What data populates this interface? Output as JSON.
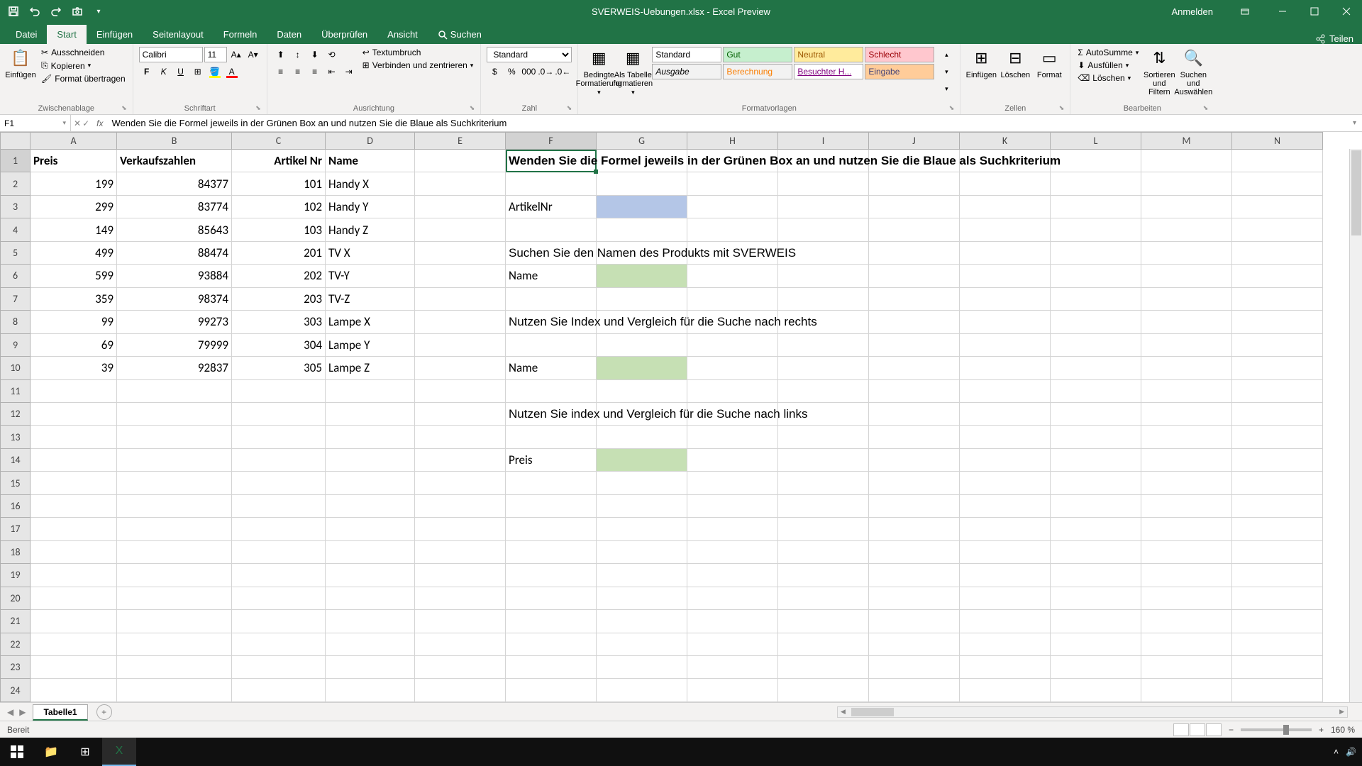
{
  "titlebar": {
    "title": "SVERWEIS-Uebungen.xlsx - Excel Preview",
    "signin": "Anmelden"
  },
  "ribbon_tabs": {
    "file": "Datei",
    "home": "Start",
    "insert": "Einfügen",
    "page_layout": "Seitenlayout",
    "formulas": "Formeln",
    "data": "Daten",
    "review": "Überprüfen",
    "view": "Ansicht",
    "search": "Suchen",
    "share": "Teilen"
  },
  "ribbon": {
    "clipboard": {
      "label": "Zwischenablage",
      "paste": "Einfügen",
      "cut": "Ausschneiden",
      "copy": "Kopieren",
      "format_painter": "Format übertragen"
    },
    "font": {
      "label": "Schriftart",
      "name": "Calibri",
      "size": "11"
    },
    "alignment": {
      "label": "Ausrichtung",
      "wrap": "Textumbruch",
      "merge": "Verbinden und zentrieren"
    },
    "number": {
      "label": "Zahl",
      "format": "Standard"
    },
    "styles": {
      "label": "Formatvorlagen",
      "conditional": "Bedingte Formatierung",
      "as_table": "Als Tabelle formatieren",
      "standard": "Standard",
      "gut": "Gut",
      "neutral": "Neutral",
      "schlecht": "Schlecht",
      "ausgabe": "Ausgabe",
      "berechnung": "Berechnung",
      "besucht": "Besuchter H...",
      "eingabe": "Eingabe"
    },
    "cells": {
      "label": "Zellen",
      "insert": "Einfügen",
      "delete": "Löschen",
      "format": "Format"
    },
    "editing": {
      "label": "Bearbeiten",
      "autosum": "AutoSumme",
      "fill": "Ausfüllen",
      "clear": "Löschen",
      "sort": "Sortieren und Filtern",
      "find": "Suchen und Auswählen"
    }
  },
  "formula_bar": {
    "cell_ref": "F1",
    "content": "Wenden Sie die Formel jeweils in der Grünen Box an und nutzen Sie die Blaue als Suchkriterium"
  },
  "columns": [
    "A",
    "B",
    "C",
    "D",
    "E",
    "F",
    "G",
    "H",
    "I",
    "J",
    "K",
    "L",
    "M",
    "N"
  ],
  "row_count": 24,
  "data_table": {
    "headers": {
      "A": "Preis",
      "B": "Verkaufszahlen",
      "C": "Artikel Nr",
      "D": "Name"
    },
    "rows": [
      {
        "A": "199",
        "B": "84377",
        "C": "101",
        "D": "Handy X"
      },
      {
        "A": "299",
        "B": "83774",
        "C": "102",
        "D": "Handy Y"
      },
      {
        "A": "149",
        "B": "85643",
        "C": "103",
        "D": "Handy Z"
      },
      {
        "A": "499",
        "B": "88474",
        "C": "201",
        "D": "TV X"
      },
      {
        "A": "599",
        "B": "93884",
        "C": "202",
        "D": "TV-Y"
      },
      {
        "A": "359",
        "B": "98374",
        "C": "203",
        "D": "TV-Z"
      },
      {
        "A": "99",
        "B": "99273",
        "C": "303",
        "D": "Lampe X"
      },
      {
        "A": "69",
        "B": "79999",
        "C": "304",
        "D": "Lampe Y"
      },
      {
        "A": "39",
        "B": "92837",
        "C": "305",
        "D": "Lampe Z"
      }
    ]
  },
  "instructions": {
    "F1": "Wenden Sie die Formel jeweils in der Grünen Box an und nutzen Sie die Blaue als Suchkriterium",
    "F3": "ArtikelNr",
    "F5": "Suchen Sie den Namen des Produkts mit SVERWEIS",
    "F6": "Name",
    "F8": "Nutzen Sie Index und Vergleich für die Suche nach rechts",
    "F10": "Name",
    "F12": "Nutzen Sie index und Vergleich für die Suche nach links",
    "F14": "Preis"
  },
  "sheet_tabs": {
    "tab1": "Tabelle1"
  },
  "statusbar": {
    "ready": "Bereit",
    "zoom": "160 %"
  }
}
